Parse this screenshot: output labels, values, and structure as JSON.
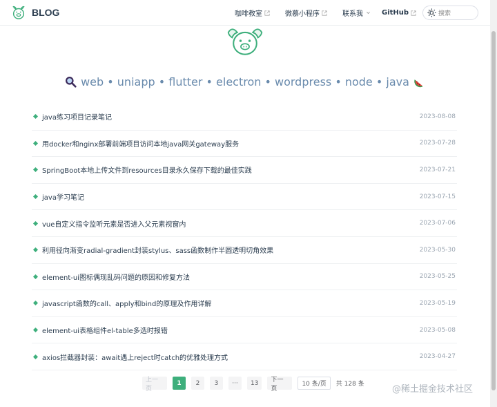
{
  "brand": {
    "title": "BLOG"
  },
  "nav": {
    "links": [
      {
        "label": "咖啡教室",
        "external": true
      },
      {
        "label": "微慕小程序",
        "external": true
      },
      {
        "label": "联系我",
        "dropdown": true
      },
      {
        "label": "GitHub",
        "external": true
      }
    ],
    "search_placeholder": "搜索"
  },
  "hero": {
    "tagline": "web • uniapp • flutter • electron • wordpress • node • java",
    "left_icon": "magnifier-icon",
    "right_icon": "watermelon-icon"
  },
  "posts": [
    {
      "title": "java练习项目记录笔记",
      "date": "2023-08-08"
    },
    {
      "title": "用docker和nginx部署前端项目访问本地java网关gateway服务",
      "date": "2023-07-28"
    },
    {
      "title": "SpringBoot本地上传文件到resources目录永久保存下载的最佳实践",
      "date": "2023-07-21"
    },
    {
      "title": "java学习笔记",
      "date": "2023-07-15"
    },
    {
      "title": "vue自定义指令监听元素是否进入父元素视窗内",
      "date": "2023-07-06"
    },
    {
      "title": "利用径向渐变radial-gradient封装stylus、sass函数制作半圆透明切角效果",
      "date": "2023-05-30"
    },
    {
      "title": "element-ui图标偶现乱码问题的原因和修复方法",
      "date": "2023-05-25"
    },
    {
      "title": "javascript函数的call、apply和bind的原理及作用详解",
      "date": "2023-05-19"
    },
    {
      "title": "element-ui表格组件el-table多选时报错",
      "date": "2023-05-08"
    },
    {
      "title": "axios拦截器封装：await遇上reject时catch的优雅处理方式",
      "date": "2023-04-27"
    }
  ],
  "pagination": {
    "prev": "上一页",
    "pages": [
      "1",
      "2",
      "3",
      "···",
      "13"
    ],
    "current": "1",
    "next": "下一页",
    "page_size": "10 条/页",
    "total": "共 128 条"
  },
  "watermark": "@稀土掘金技术社区",
  "colors": {
    "accent": "#3eaf7c",
    "text": "#2c3e50",
    "hero": "#6a8bad"
  }
}
